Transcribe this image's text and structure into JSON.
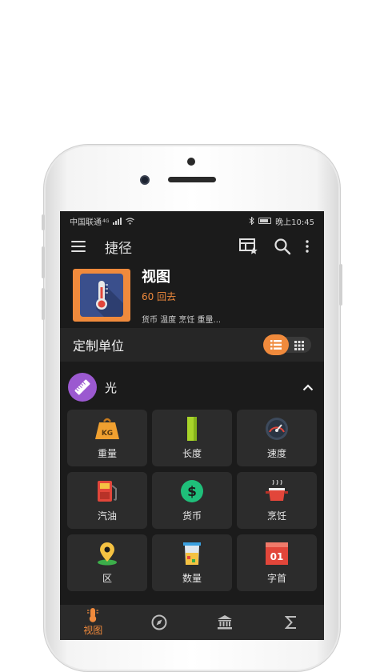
{
  "status": {
    "carrier": "中国联通",
    "network": "4G",
    "time": "晚上10:45"
  },
  "appbar": {
    "title": "捷径"
  },
  "header": {
    "title": "视图",
    "subtitle": "60 回去",
    "tags": "货币 温度 烹饪 重量..."
  },
  "section": {
    "title": "定制单位"
  },
  "group": {
    "name": "光"
  },
  "tiles": [
    {
      "label": "重量",
      "icon": "weight-icon"
    },
    {
      "label": "长度",
      "icon": "ruler-icon"
    },
    {
      "label": "速度",
      "icon": "speedometer-icon"
    },
    {
      "label": "汽油",
      "icon": "fuel-pump-icon"
    },
    {
      "label": "货币",
      "icon": "dollar-icon"
    },
    {
      "label": "烹饪",
      "icon": "cooking-pot-icon"
    },
    {
      "label": "区",
      "icon": "map-pin-icon"
    },
    {
      "label": "数量",
      "icon": "beaker-icon"
    },
    {
      "label": "字首",
      "icon": "prefix-icon"
    }
  ],
  "tile_prefix_text": "01",
  "weight_badge": "KG",
  "bottom_nav": {
    "active_label": "视图",
    "items": [
      "thermometer-icon",
      "compass-icon",
      "bank-icon",
      "sigma-icon"
    ]
  },
  "colors": {
    "accent": "#f08a3c",
    "screen_bg": "#1b1b1b",
    "tile_bg": "#2c2c2c",
    "group_icon": "#9b59d0"
  }
}
